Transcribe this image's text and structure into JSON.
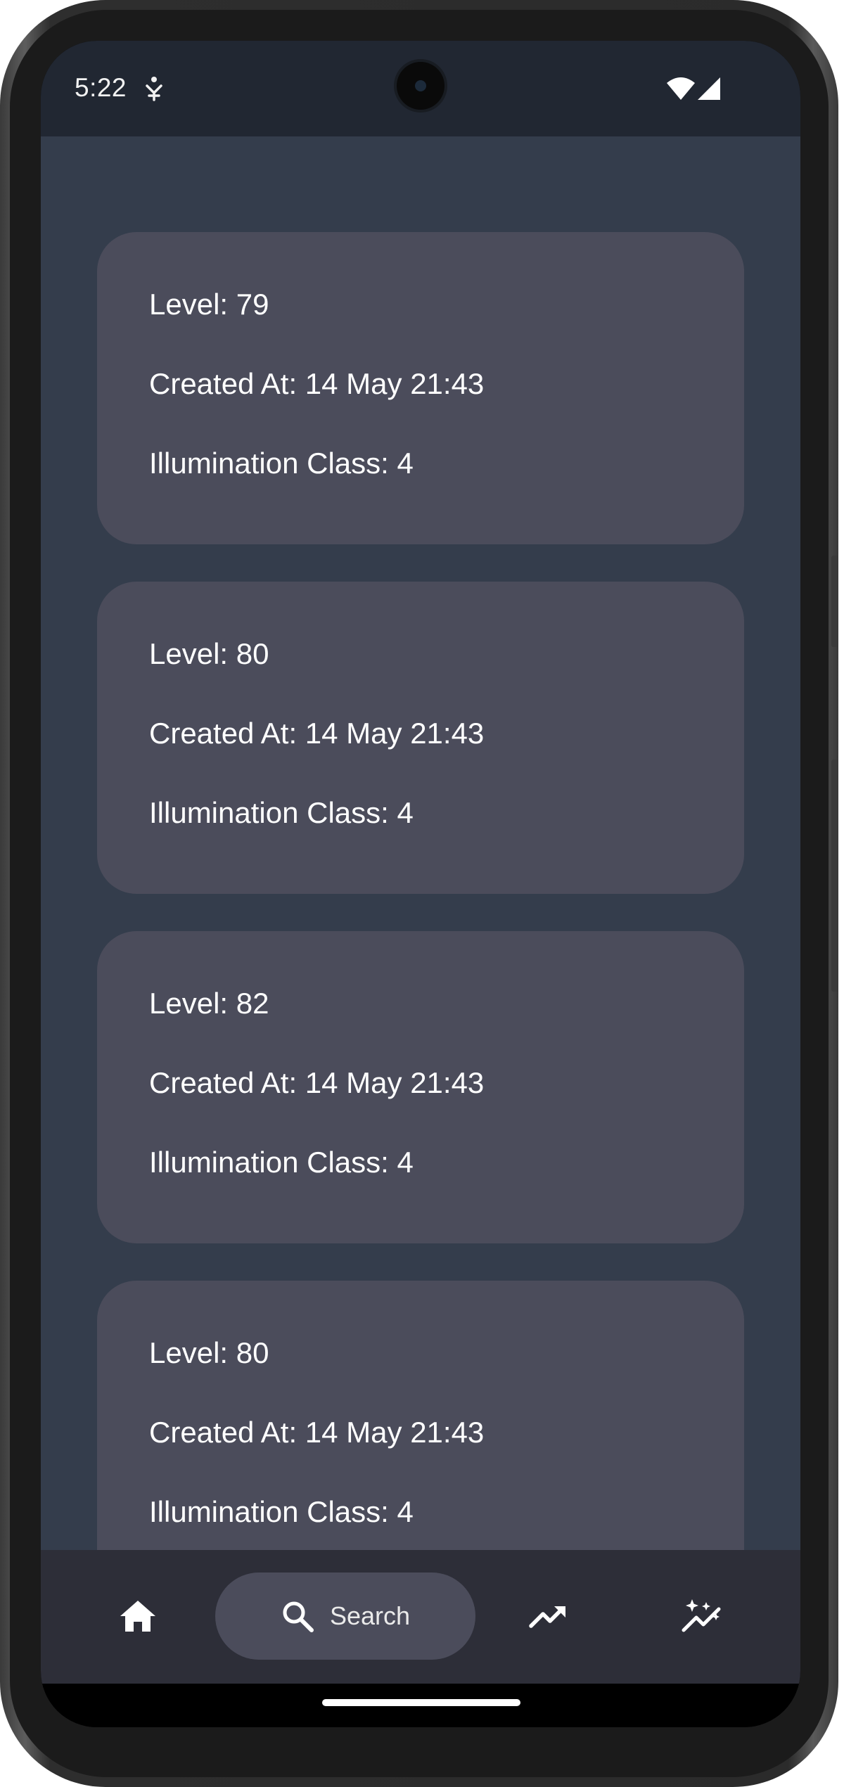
{
  "status_bar": {
    "time": "5:22",
    "icons": [
      "notification-icon",
      "wifi-icon",
      "signal-icon"
    ]
  },
  "cards": [
    {
      "level": "Level: 79",
      "created_at": "Created At: 14 May 21:43",
      "illumination_class": "Illumination Class: 4"
    },
    {
      "level": "Level: 80",
      "created_at": "Created At: 14 May 21:43",
      "illumination_class": "Illumination Class: 4"
    },
    {
      "level": "Level: 82",
      "created_at": "Created At: 14 May 21:43",
      "illumination_class": "Illumination Class: 4"
    },
    {
      "level": "Level: 80",
      "created_at": "Created At: 14 May 21:43",
      "illumination_class": "Illumination Class: 4"
    }
  ],
  "nav": {
    "items": [
      {
        "icon": "home-icon",
        "label": ""
      },
      {
        "icon": "search-icon",
        "label": "Search",
        "selected": true
      },
      {
        "icon": "trending-up-icon",
        "label": ""
      },
      {
        "icon": "sparkle-chart-icon",
        "label": ""
      }
    ]
  },
  "colors": {
    "status_bar_bg": "#212732",
    "content_bg": "#343d4c",
    "card_bg": "#4b4c5b",
    "nav_bg": "#2d2e38",
    "text": "#ffffff"
  }
}
